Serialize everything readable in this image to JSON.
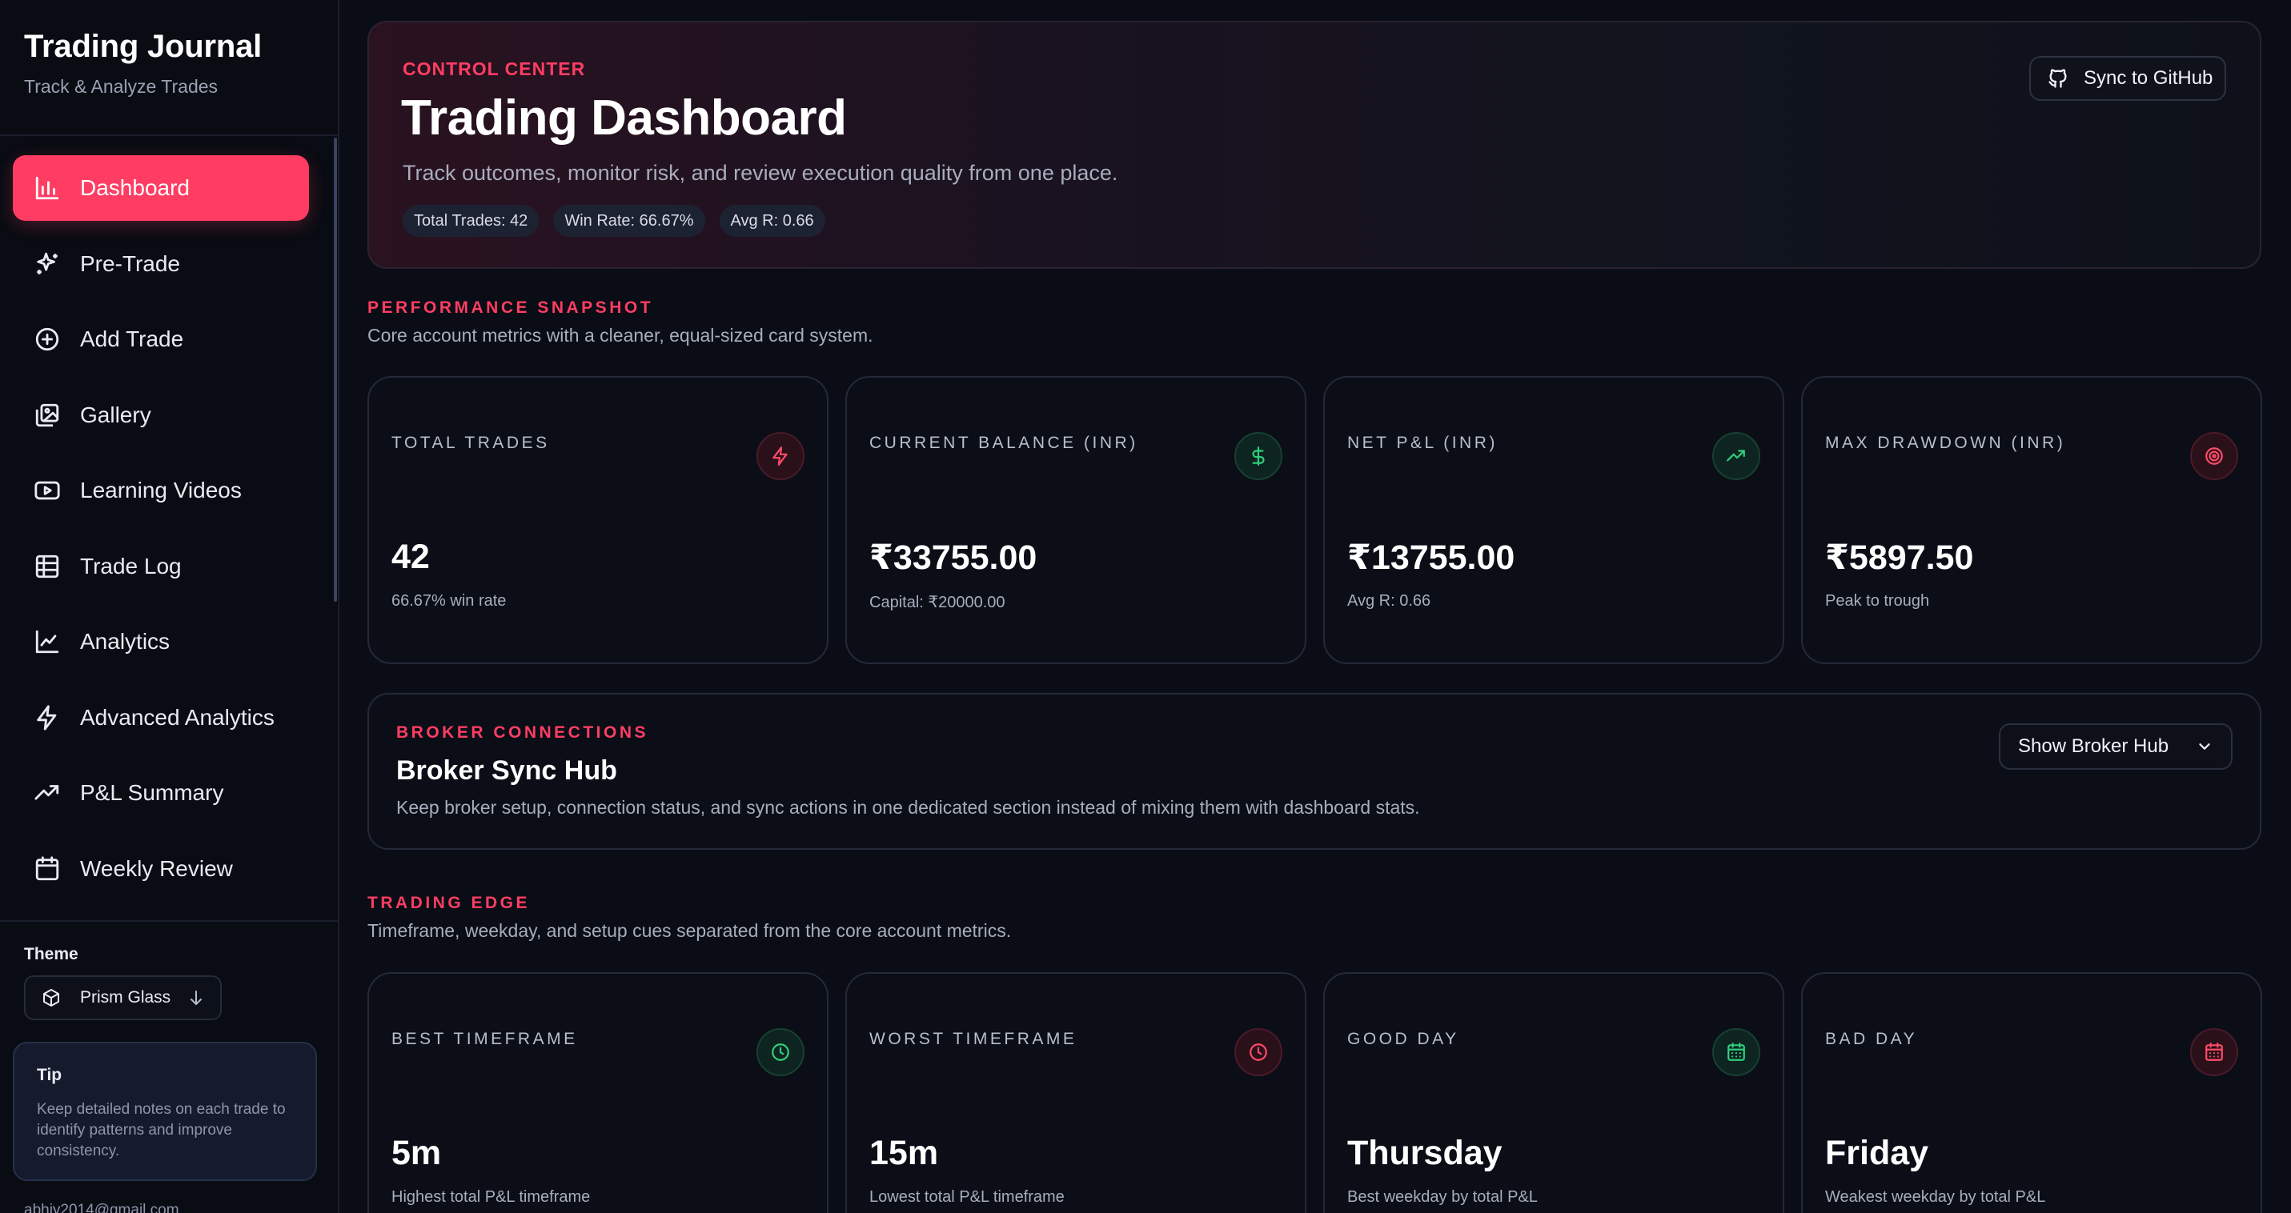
{
  "app": {
    "title": "Trading Journal",
    "subtitle": "Track & Analyze Trades"
  },
  "sidebar": {
    "items": [
      {
        "label": "Dashboard",
        "icon": "bar-chart-icon",
        "active": true
      },
      {
        "label": "Pre-Trade",
        "icon": "sparkles-icon"
      },
      {
        "label": "Add Trade",
        "icon": "plus-circle-icon"
      },
      {
        "label": "Gallery",
        "icon": "images-icon"
      },
      {
        "label": "Learning Videos",
        "icon": "video-icon"
      },
      {
        "label": "Trade Log",
        "icon": "table-icon"
      },
      {
        "label": "Analytics",
        "icon": "line-chart-icon"
      },
      {
        "label": "Advanced Analytics",
        "icon": "lightning-icon"
      },
      {
        "label": "P&L Summary",
        "icon": "trending-up-icon"
      },
      {
        "label": "Weekly Review",
        "icon": "calendar-icon"
      }
    ],
    "theme_label": "Theme",
    "theme_value": "Prism Glass",
    "tip_title": "Tip",
    "tip_text": "Keep detailed notes on each trade to identify patterns and improve consistency.",
    "email": "abhiy2014@gmail.com"
  },
  "hero": {
    "eyebrow": "CONTROL CENTER",
    "title": "Trading Dashboard",
    "description": "Track outcomes, monitor risk, and review execution quality from one place.",
    "chips": [
      "Total Trades: 42",
      "Win Rate: 66.67%",
      "Avg R: 0.66"
    ],
    "sync_label": "Sync to GitHub"
  },
  "performance": {
    "eyebrow": "PERFORMANCE SNAPSHOT",
    "description": "Core account metrics with a cleaner, equal-sized card system.",
    "cards": [
      {
        "label": "TOTAL TRADES",
        "value": "42",
        "sub": "66.67% win rate",
        "icon": "lightning-icon",
        "tone": "red"
      },
      {
        "label": "CURRENT BALANCE (INR)",
        "value": "₹33755.00",
        "sub": "Capital: ₹20000.00",
        "icon": "dollar-icon",
        "tone": "green"
      },
      {
        "label": "NET P&L (INR)",
        "value": "₹13755.00",
        "sub": "Avg R: 0.66",
        "icon": "trending-up-icon",
        "tone": "green"
      },
      {
        "label": "MAX DRAWDOWN (INR)",
        "value": "₹5897.50",
        "sub": "Peak to trough",
        "icon": "target-icon",
        "tone": "red"
      }
    ]
  },
  "broker": {
    "eyebrow": "BROKER CONNECTIONS",
    "title": "Broker Sync Hub",
    "description": "Keep broker setup, connection status, and sync actions in one dedicated section instead of mixing them with dashboard stats.",
    "button_label": "Show Broker Hub"
  },
  "edge": {
    "eyebrow": "TRADING EDGE",
    "description": "Timeframe, weekday, and setup cues separated from the core account metrics.",
    "cards": [
      {
        "label": "BEST TIMEFRAME",
        "value": "5m",
        "sub": "Highest total P&L timeframe",
        "icon": "clock-icon",
        "tone": "green"
      },
      {
        "label": "WORST TIMEFRAME",
        "value": "15m",
        "sub": "Lowest total P&L timeframe",
        "icon": "clock-icon",
        "tone": "red"
      },
      {
        "label": "GOOD DAY",
        "value": "Thursday",
        "sub": "Best weekday by total P&L",
        "icon": "calendar-check-icon",
        "tone": "green"
      },
      {
        "label": "BAD DAY",
        "value": "Friday",
        "sub": "Weakest weekday by total P&L",
        "icon": "calendar-icon",
        "tone": "red"
      }
    ]
  },
  "colors": {
    "accent": "#ff3d63",
    "positive": "#2fd07c",
    "background": "#0a0d15"
  }
}
